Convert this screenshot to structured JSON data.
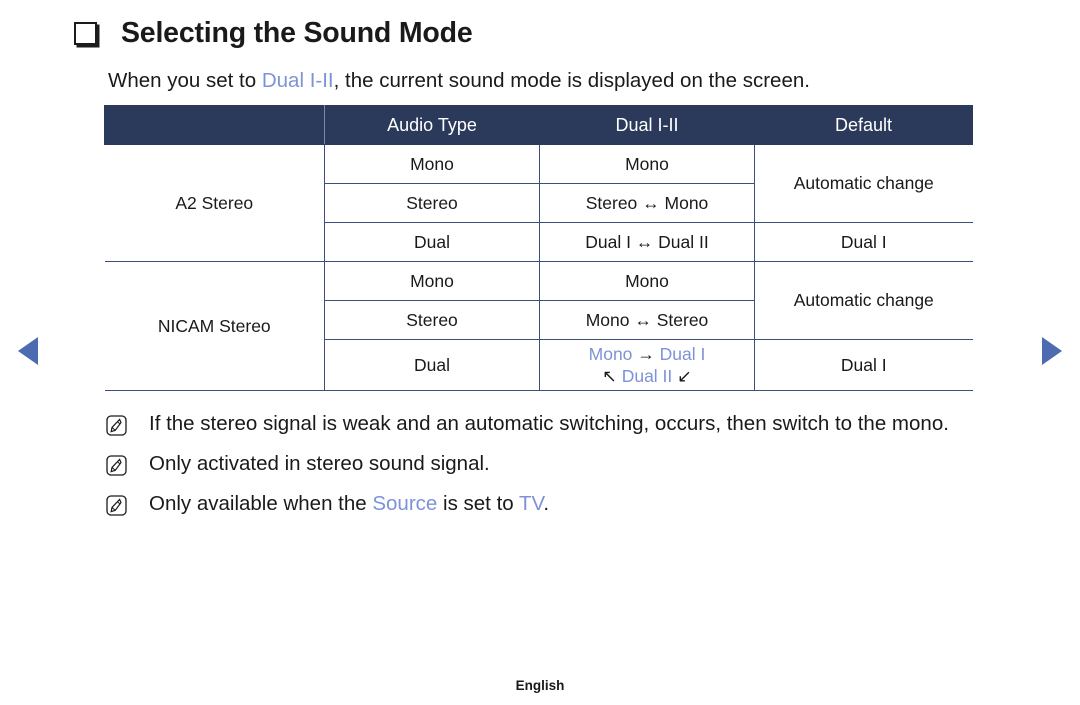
{
  "nav": {
    "prev_icon": "triangle-left-icon",
    "next_icon": "triangle-right-icon",
    "accent": "#4c6bb0"
  },
  "title": {
    "bullet_icon": "square-bullet-icon",
    "text": "Selecting the Sound Mode"
  },
  "intro": {
    "before": "When you set to ",
    "highlight": "Dual I-II",
    "after": ", the current sound mode is displayed on the screen."
  },
  "table": {
    "headers": {
      "blank": "",
      "audio_type": "Audio Type",
      "dual": "Dual I-II",
      "default": "Default"
    },
    "header_bg": "#2b3a5b",
    "accent_blue": "#7e92d8",
    "blocks": [
      {
        "name": "A2 Stereo",
        "rows": [
          {
            "audio_type": "Mono",
            "dual": "Mono",
            "default": "Automatic change"
          },
          {
            "audio_type": "Stereo",
            "dual": "Stereo ↔ Mono",
            "default": ""
          },
          {
            "audio_type": "Dual",
            "dual": "Dual I ↔ Dual II",
            "default": "Dual I"
          }
        ]
      },
      {
        "name": "NICAM Stereo",
        "rows": [
          {
            "audio_type": "Mono",
            "dual": "Mono",
            "default": "Automatic change"
          },
          {
            "audio_type": "Stereo",
            "dual": "Mono ↔ Stereo",
            "default": ""
          },
          {
            "audio_type": "Dual",
            "dual_line1_a": "Mono ",
            "dual_line1_arrow": "→",
            "dual_line1_b": " Dual I",
            "dual_line2_arrow1": "↖",
            "dual_line2_b": " Dual II ",
            "dual_line2_arrow2": "↙",
            "default": "Dual I"
          }
        ]
      }
    ]
  },
  "notes": [
    {
      "icon": "note-pencil-icon",
      "text": "If the stereo signal is weak and an automatic switching, occurs, then switch to the mono."
    },
    {
      "icon": "note-pencil-icon",
      "text": "Only activated in stereo sound signal."
    },
    {
      "icon": "note-pencil-icon",
      "prefix": "Only available when the ",
      "hl1": "Source",
      "middle": " is set to ",
      "hl2": "TV",
      "suffix": "."
    }
  ],
  "footer": {
    "language": "English"
  }
}
